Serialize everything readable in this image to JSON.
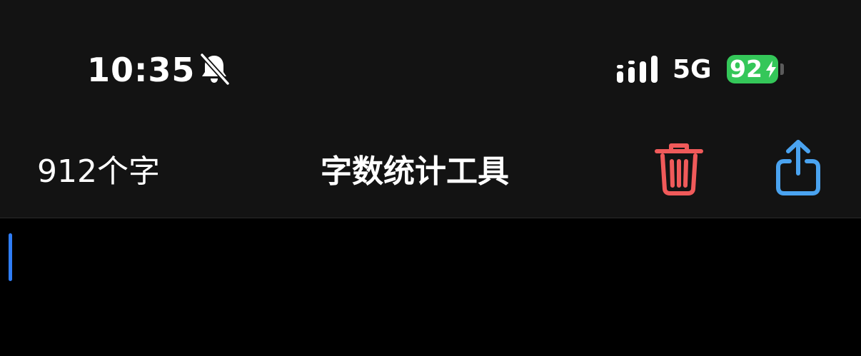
{
  "status_bar": {
    "time": "10:35",
    "network": "5G",
    "battery_level": "92"
  },
  "nav_bar": {
    "word_count": "912个字",
    "title": "字数统计工具"
  },
  "colors": {
    "trash": "#f05a5a",
    "share": "#4aa3f0",
    "battery": "#34c759",
    "caret": "#2f7df6"
  }
}
